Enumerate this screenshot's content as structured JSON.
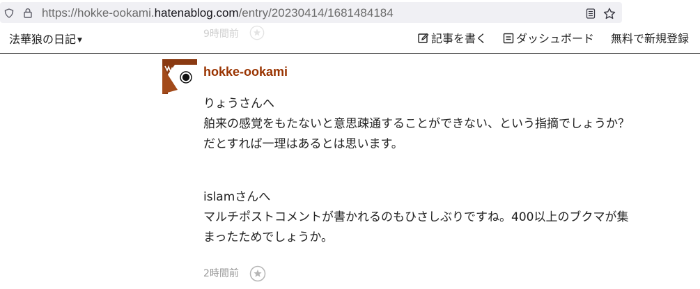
{
  "browser": {
    "url_prefix": "https://hokke-ookami.",
    "url_domain": "hatenablog.com",
    "url_path": "/entry/20230414/1681484184",
    "icons": [
      "shield-icon",
      "lock-icon",
      "reader-view-icon",
      "bookmark-star-icon"
    ]
  },
  "toolbar": {
    "blog_title": "法華狼の日記",
    "write_label": "記事を書く",
    "dashboard_label": "ダッシュボード",
    "signup_label": "無料で新規登録",
    "above_timestamp": "9時間前"
  },
  "comment": {
    "username": "hokke-ookami",
    "paragraph1": [
      "りょうさんへ",
      "舶来の感覚をもたないと意思疎通することができない、という指摘でしょうか？",
      "だとすれば一理はあるとは思います。"
    ],
    "paragraph2": [
      "islamさんへ",
      "マルチポストコメントが書かれるのもひさしぶりですね。400以上のブクマが集",
      "まったためでしょうか。"
    ],
    "timestamp": "2時間前"
  },
  "colors": {
    "username": "#993300",
    "url_bar_bg": "#f0f0f4",
    "muted_text": "#999999"
  }
}
